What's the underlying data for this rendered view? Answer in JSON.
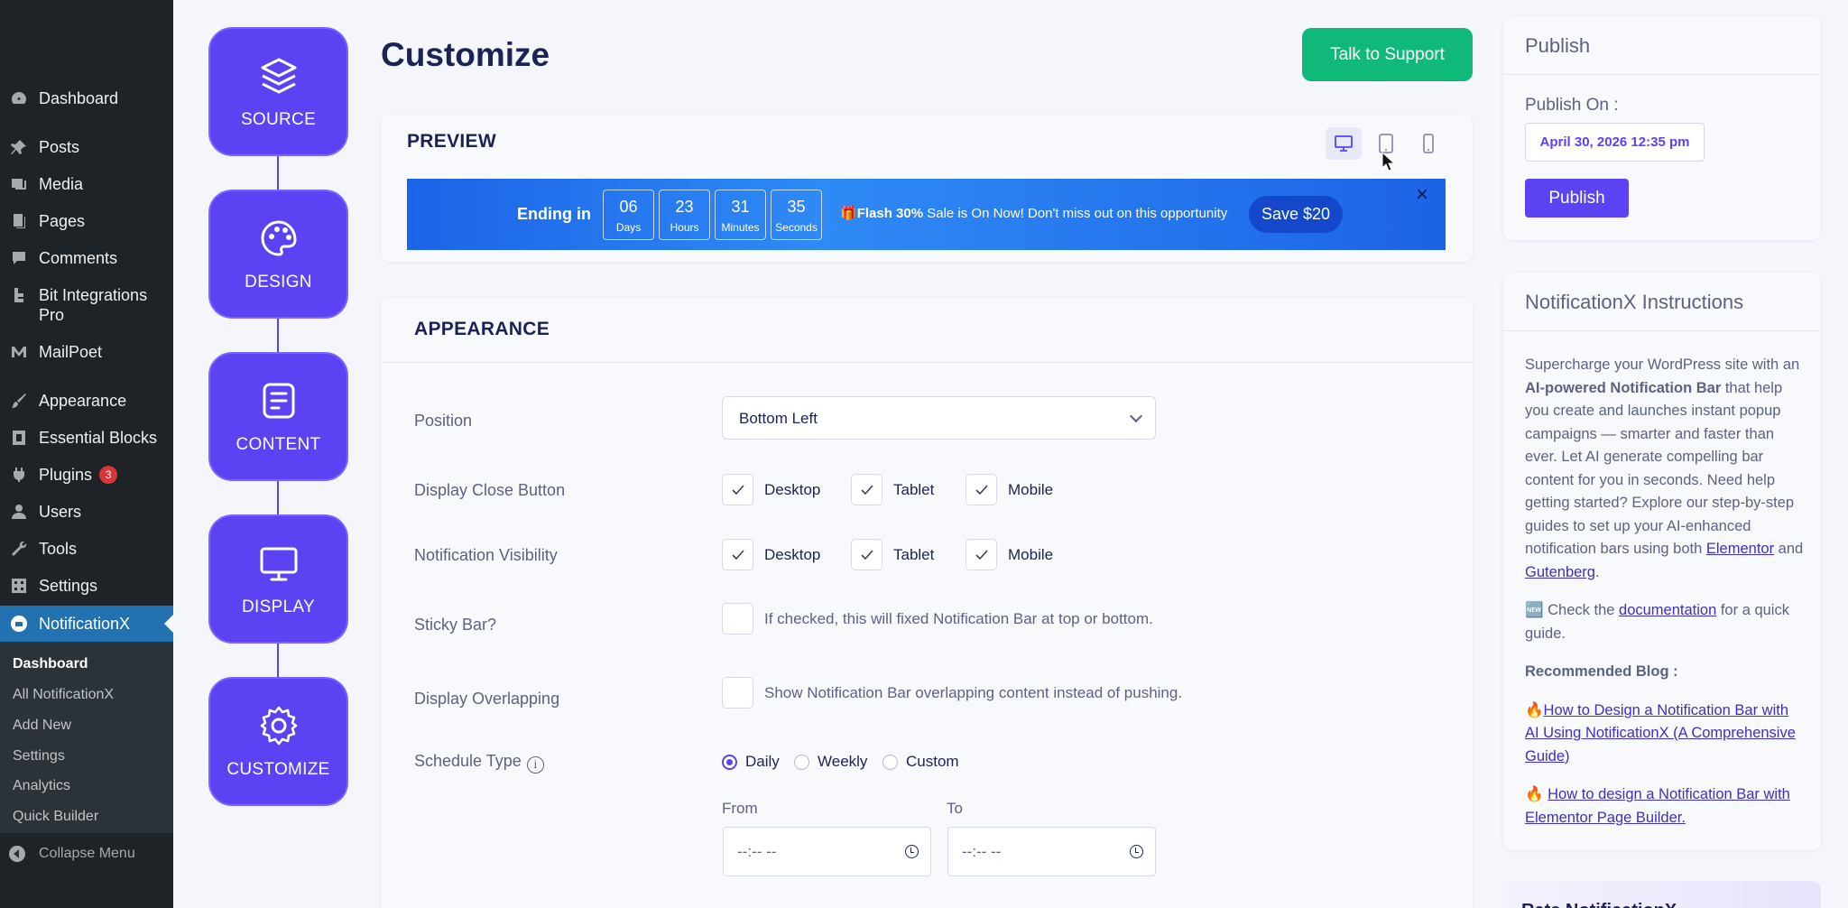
{
  "admin_menu": {
    "items": [
      {
        "label": "Dashboard",
        "icon": "dashboard-icon"
      },
      {
        "label": "Posts",
        "icon": "pin-icon"
      },
      {
        "label": "Media",
        "icon": "media-icon"
      },
      {
        "label": "Pages",
        "icon": "pages-icon"
      },
      {
        "label": "Comments",
        "icon": "comment-icon"
      },
      {
        "label": "Bit Integrations Pro",
        "icon": "bit-icon"
      },
      {
        "label": "MailPoet",
        "icon": "mailpoet-icon"
      },
      {
        "label": "Appearance",
        "icon": "brush-icon"
      },
      {
        "label": "Essential Blocks",
        "icon": "blocks-icon"
      },
      {
        "label": "Plugins",
        "icon": "plugin-icon",
        "badge": "3"
      },
      {
        "label": "Users",
        "icon": "user-icon"
      },
      {
        "label": "Tools",
        "icon": "wrench-icon"
      },
      {
        "label": "Settings",
        "icon": "settings-icon"
      },
      {
        "label": "NotificationX",
        "icon": "notificationx-icon"
      }
    ],
    "submenu": [
      "Dashboard",
      "All NotificationX",
      "Add New",
      "Settings",
      "Analytics",
      "Quick Builder"
    ],
    "collapse_label": "Collapse Menu"
  },
  "steps": [
    "SOURCE",
    "DESIGN",
    "CONTENT",
    "DISPLAY",
    "CUSTOMIZE"
  ],
  "page_title": "Customize",
  "support_button": "Talk to Support",
  "preview": {
    "title": "PREVIEW",
    "devices": [
      "desktop",
      "tablet",
      "mobile"
    ],
    "active_device": "desktop",
    "banner": {
      "ending_label": "Ending in",
      "countdown": [
        {
          "value": "06",
          "unit": "Days"
        },
        {
          "value": "23",
          "unit": "Hours"
        },
        {
          "value": "31",
          "unit": "Minutes"
        },
        {
          "value": "35",
          "unit": "Seconds"
        }
      ],
      "gift": "🎁",
      "flash_bold": "Flash 30%",
      "flash_rest": " Sale is On Now! Don't miss out on this opportunity",
      "save_button": "Save $20",
      "close": "×"
    }
  },
  "appearance": {
    "title": "APPEARANCE",
    "position_label": "Position",
    "position_value": "Bottom Left",
    "close_button_label": "Display Close Button",
    "visibility_label": "Notification Visibility",
    "devices": [
      "Desktop",
      "Tablet",
      "Mobile"
    ],
    "sticky_label": "Sticky Bar?",
    "sticky_text": "If checked, this will fixed Notification Bar at top or bottom.",
    "overlap_label": "Display Overlapping",
    "overlap_text": "Show Notification Bar overlapping content instead of pushing.",
    "schedule_label": "Schedule Type",
    "schedule_options": [
      "Daily",
      "Weekly",
      "Custom"
    ],
    "schedule_selected": "Daily",
    "from_label": "From",
    "to_label": "To",
    "time_placeholder": "--:-- --"
  },
  "publish": {
    "title": "Publish",
    "publish_on_label": "Publish On :",
    "date": "April 30, 2026 12:35 pm",
    "button": "Publish"
  },
  "instructions": {
    "title": "NotificationX Instructions",
    "p1_a": "Supercharge your WordPress site with an ",
    "p1_b": "AI-powered Notification Bar",
    "p1_c": " that help you create and launches instant popup campaigns — smarter and faster than ever. Let AI generate compelling bar content for you in seconds. Need help getting started? Explore our step-by-step guides to set up your AI-enhanced notification bars using both ",
    "p1_link1": "Elementor",
    "p1_and": " and ",
    "p1_link2": "Gutenberg",
    "p1_end": ".",
    "p2_icon": "🆕",
    "p2_a": " Check the ",
    "p2_link": "documentation",
    "p2_b": " for a quick guide.",
    "blog_label": "Recommended Blog :",
    "blog1_icon": "🔥",
    "blog1": "How to Design a Notification Bar with AI Using NotificationX (A Comprehensive Guide)",
    "blog2_icon": "🔥",
    "blog2": "How to design a Notification Bar with Elementor Page Builder."
  },
  "rate_title": "Rate NotificationX",
  "colors": {
    "accent": "#5b42f3",
    "support": "#10b87a",
    "wp_sidebar": "#1d2327",
    "wp_active": "#2271b1",
    "banner": "#1b63e8"
  }
}
